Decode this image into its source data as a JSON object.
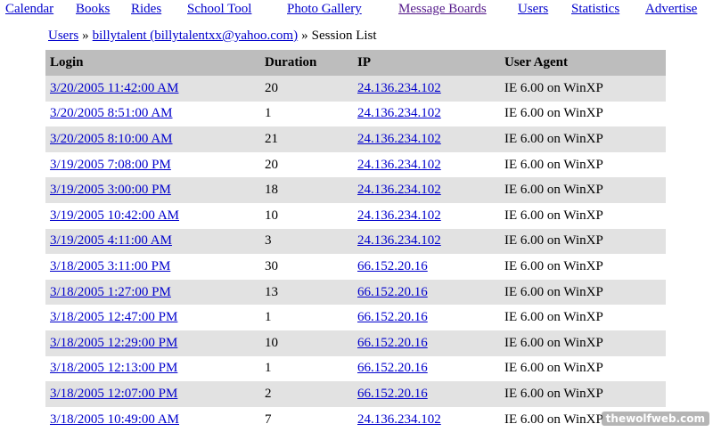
{
  "nav": {
    "items": [
      {
        "label": "Calendar"
      },
      {
        "label": "Books"
      },
      {
        "label": "Rides"
      },
      {
        "label": "School Tool"
      },
      {
        "label": "Photo Gallery"
      },
      {
        "label": "Message Boards"
      },
      {
        "label": "Users"
      },
      {
        "label": "Statistics"
      },
      {
        "label": "Advertise"
      }
    ]
  },
  "breadcrumb": {
    "users_link": "Users",
    "separator": "»",
    "user_link": "billytalent (billytalentxx@yahoo.com)",
    "current": "Session List"
  },
  "table": {
    "headers": {
      "login": "Login",
      "duration": "Duration",
      "ip": "IP",
      "agent": "User Agent"
    },
    "rows": [
      {
        "login": "3/20/2005 11:42:00 AM",
        "duration": "20",
        "ip": "24.136.234.102",
        "agent": "IE 6.00 on WinXP"
      },
      {
        "login": "3/20/2005 8:51:00 AM",
        "duration": "1",
        "ip": "24.136.234.102",
        "agent": "IE 6.00 on WinXP"
      },
      {
        "login": "3/20/2005 8:10:00 AM",
        "duration": "21",
        "ip": "24.136.234.102",
        "agent": "IE 6.00 on WinXP"
      },
      {
        "login": "3/19/2005 7:08:00 PM",
        "duration": "20",
        "ip": "24.136.234.102",
        "agent": "IE 6.00 on WinXP"
      },
      {
        "login": "3/19/2005 3:00:00 PM",
        "duration": "18",
        "ip": "24.136.234.102",
        "agent": "IE 6.00 on WinXP"
      },
      {
        "login": "3/19/2005 10:42:00 AM",
        "duration": "10",
        "ip": "24.136.234.102",
        "agent": "IE 6.00 on WinXP"
      },
      {
        "login": "3/19/2005 4:11:00 AM",
        "duration": "3",
        "ip": "24.136.234.102",
        "agent": "IE 6.00 on WinXP"
      },
      {
        "login": "3/18/2005 3:11:00 PM",
        "duration": "30",
        "ip": "66.152.20.16",
        "agent": "IE 6.00 on WinXP"
      },
      {
        "login": "3/18/2005 1:27:00 PM",
        "duration": "13",
        "ip": "66.152.20.16",
        "agent": "IE 6.00 on WinXP"
      },
      {
        "login": "3/18/2005 12:47:00 PM",
        "duration": "1",
        "ip": "66.152.20.16",
        "agent": "IE 6.00 on WinXP"
      },
      {
        "login": "3/18/2005 12:29:00 PM",
        "duration": "10",
        "ip": "66.152.20.16",
        "agent": "IE 6.00 on WinXP"
      },
      {
        "login": "3/18/2005 12:13:00 PM",
        "duration": "1",
        "ip": "66.152.20.16",
        "agent": "IE 6.00 on WinXP"
      },
      {
        "login": "3/18/2005 12:07:00 PM",
        "duration": "2",
        "ip": "66.152.20.16",
        "agent": "IE 6.00 on WinXP"
      },
      {
        "login": "3/18/2005 10:49:00 AM",
        "duration": "7",
        "ip": "24.136.234.102",
        "agent": "IE 6.00 on WinXP"
      }
    ]
  },
  "watermark": "thewolfweb.com"
}
